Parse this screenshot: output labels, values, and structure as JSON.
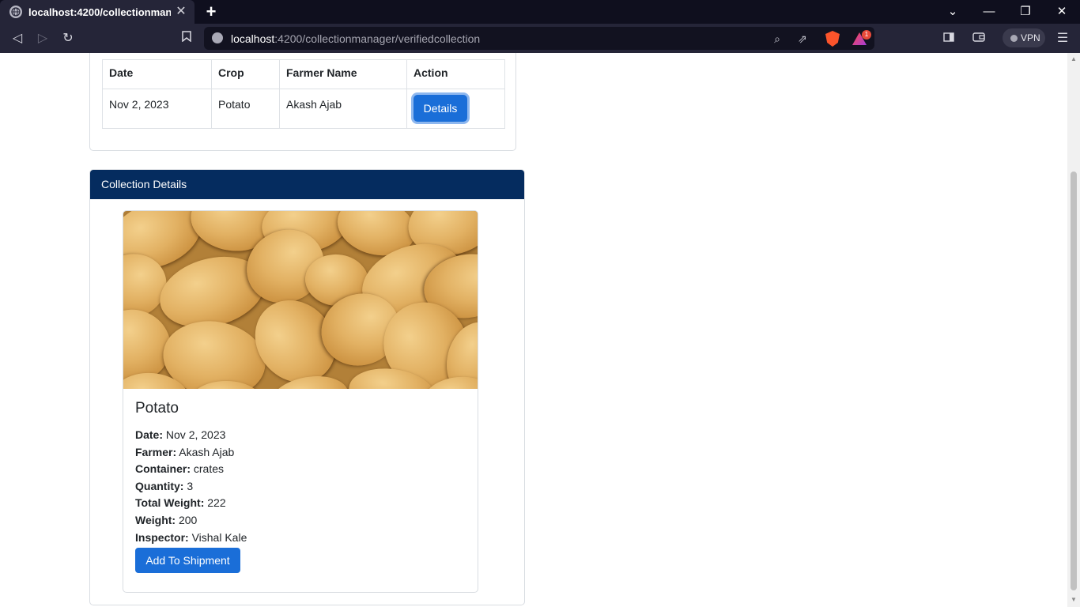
{
  "browser": {
    "tab_title": "localhost:4200/collectionmanager/verifiedcollection",
    "url_host": "localhost",
    "url_path": ":4200/collectionmanager/verifiedcollection",
    "vpn_label": "VPN",
    "rewards_count": "1"
  },
  "collections_table": {
    "headers": {
      "date": "Date",
      "crop": "Crop",
      "farmer": "Farmer Name",
      "action": "Action"
    },
    "rows": [
      {
        "date": "Nov 2, 2023",
        "crop": "Potato",
        "farmer": "Akash Ajab",
        "action": "Details"
      }
    ]
  },
  "details": {
    "header": "Collection Details",
    "crop_title": "Potato",
    "fields": {
      "date": {
        "label": "Date:",
        "value": "Nov 2, 2023"
      },
      "farmer": {
        "label": "Farmer:",
        "value": "Akash Ajab"
      },
      "container": {
        "label": "Container:",
        "value": "crates"
      },
      "quantity": {
        "label": "Quantity:",
        "value": "3"
      },
      "total_weight": {
        "label": "Total Weight:",
        "value": "222"
      },
      "weight": {
        "label": "Weight:",
        "value": "200"
      },
      "inspector": {
        "label": "Inspector:",
        "value": "Vishal Kale"
      }
    },
    "add_button": "Add To Shipment"
  },
  "colors": {
    "primary_button": "#1a6ed8",
    "card_header": "#052c5f"
  }
}
